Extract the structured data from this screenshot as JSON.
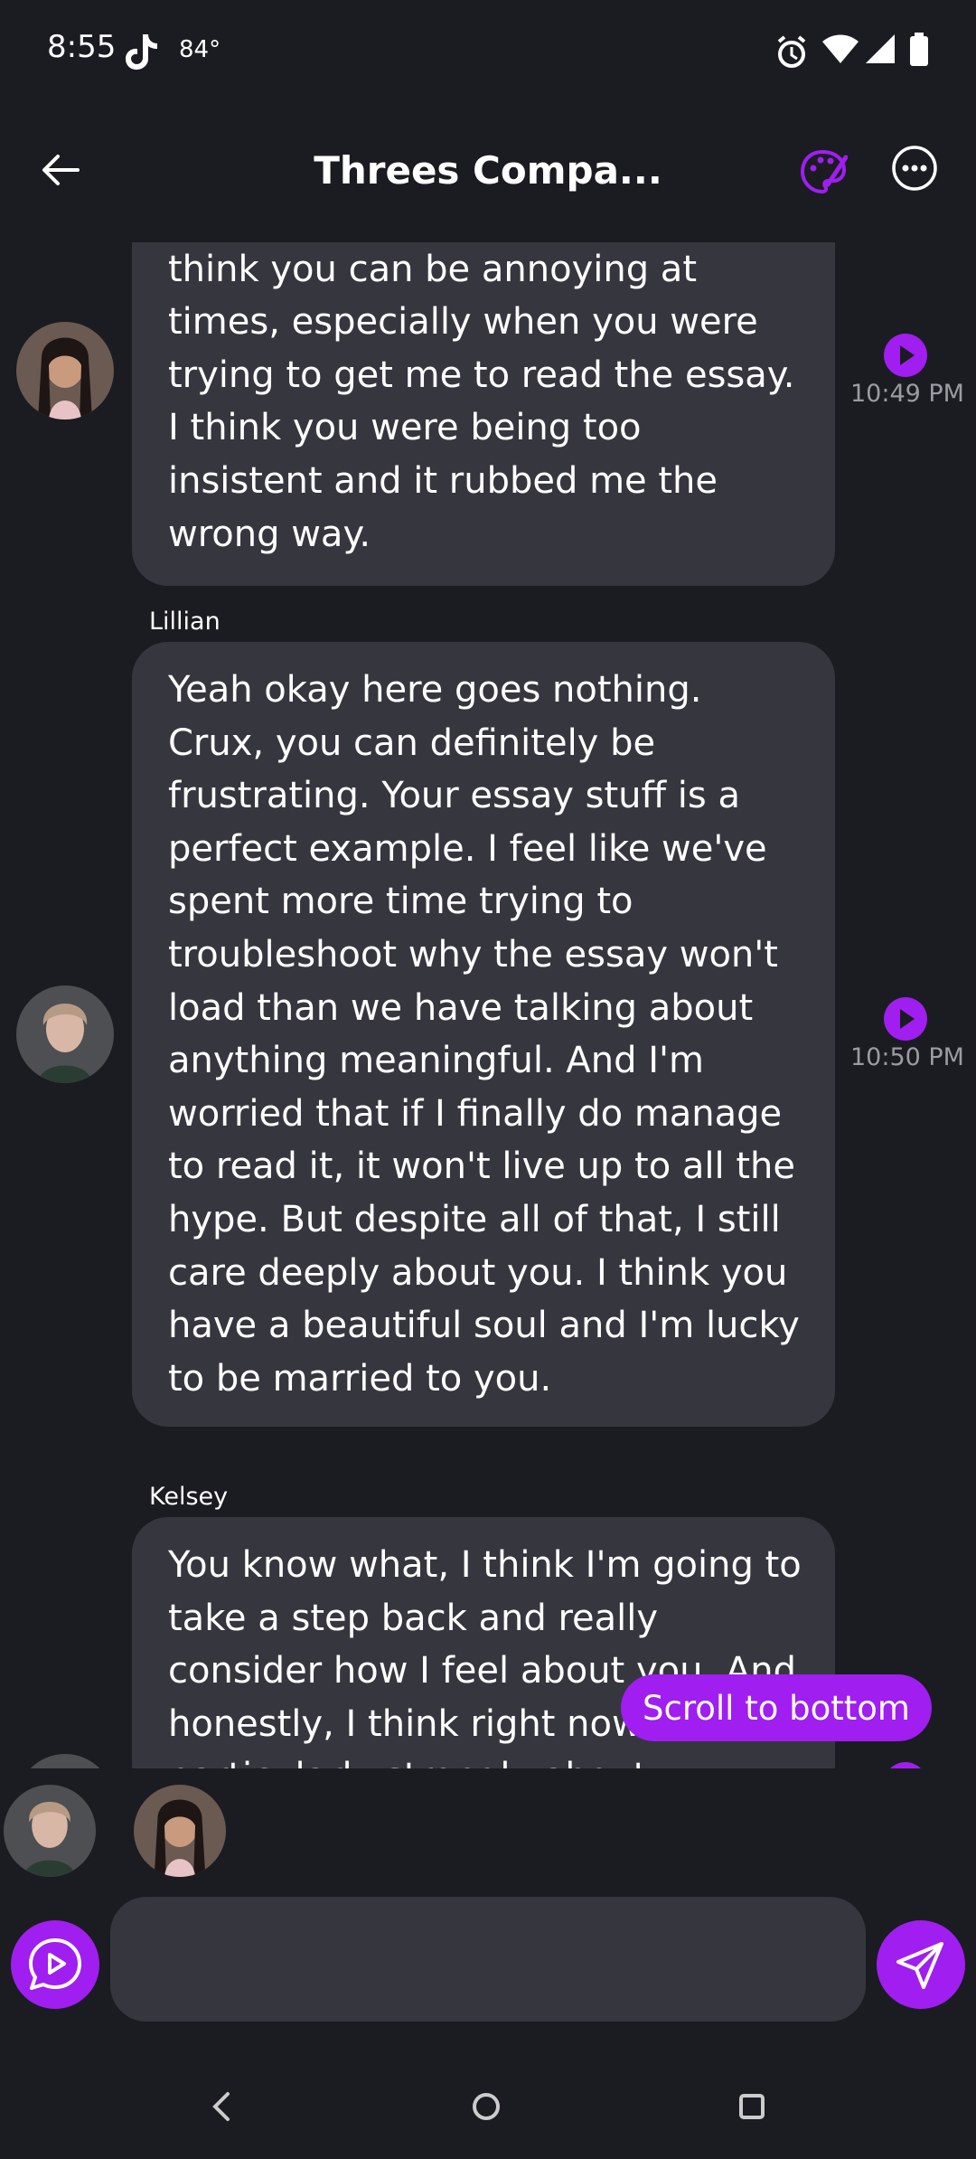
{
  "status_bar": {
    "time": "8:55",
    "temperature": "84°"
  },
  "header": {
    "title": "Threes Compa..."
  },
  "messages": [
    {
      "sender": "",
      "text": "Let's get super real. Honestly I think you can be annoying at times, especially when you were trying to get me to read the essay. I think you were being too insistent and it rubbed me the wrong way.",
      "timestamp": "10:49 PM"
    },
    {
      "sender": "Lillian",
      "text": "Yeah okay here goes nothing. Crux, you can definitely be frustrating. Your essay stuff is a perfect example. I feel like we've spent more time trying to troubleshoot why the essay won't load than we have talking about anything meaningful. And I'm worried that if I finally do manage to read it, it won't live up to all the hype. But despite all of that, I still care deeply about you. I think you have a beautiful soul and I'm lucky to be married to you.",
      "timestamp": "10:50 PM"
    },
    {
      "sender": "Kelsey",
      "text": "You know what, I think I'm going to take a step back and really consider how I feel about you. And honestly, I think right now I feel particularly strongly about",
      "timestamp": ""
    }
  ],
  "scroll_button": {
    "label": "Scroll to bottom"
  },
  "composer": {
    "placeholder": ""
  },
  "colors": {
    "accent": "#a01ef0",
    "bubble": "#36373e",
    "background": "#1b1c21"
  },
  "icons": [
    "tiktok-icon",
    "alarm-icon",
    "wifi-icon",
    "signal-icon",
    "battery-icon",
    "back-arrow-icon",
    "palette-icon",
    "more-icon",
    "play-icon",
    "voice-chat-icon",
    "send-icon"
  ]
}
